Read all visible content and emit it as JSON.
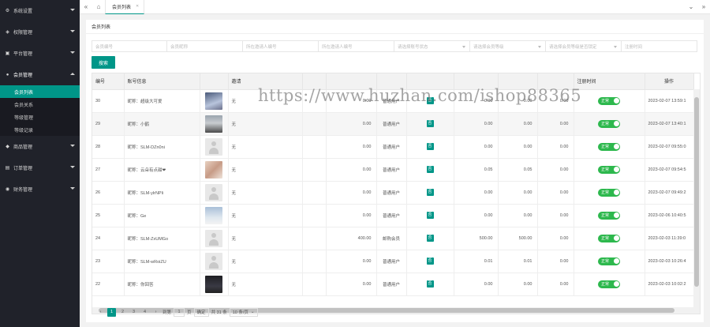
{
  "sidebar": {
    "items": [
      {
        "label": "系统设置",
        "icon": "gear-icon"
      },
      {
        "label": "权限管理",
        "icon": "shield-icon"
      },
      {
        "label": "平台管理",
        "icon": "platform-icon"
      },
      {
        "label": "会员管理",
        "icon": "user-icon",
        "open": true
      },
      {
        "label": "商品管理",
        "icon": "goods-icon"
      },
      {
        "label": "订单管理",
        "icon": "order-icon"
      },
      {
        "label": "财务管理",
        "icon": "finance-icon"
      }
    ],
    "sub_items": [
      "会员列表",
      "会员关系",
      "等级管理",
      "等级记录"
    ]
  },
  "topbar": {
    "tab_label": "会员列表"
  },
  "panel": {
    "title": "会员列表"
  },
  "filters": [
    {
      "placeholder": "会员编号",
      "type": "input"
    },
    {
      "placeholder": "会员昵称",
      "type": "input"
    },
    {
      "placeholder": "所在邀请人编号",
      "type": "input"
    },
    {
      "placeholder": "所在邀请人编号",
      "type": "input"
    },
    {
      "placeholder": "请选择账号状态",
      "type": "select"
    },
    {
      "placeholder": "请选择会员等级",
      "type": "select"
    },
    {
      "placeholder": "请选择会员等级是否锁定",
      "type": "select"
    },
    {
      "placeholder": "注册时间",
      "type": "input"
    }
  ],
  "search_label": "搜索",
  "table": {
    "headers": [
      "编号",
      "账号信息",
      "",
      "邀请",
      "",
      "",
      "",
      "",
      "",
      "",
      "注册时间",
      "操作"
    ],
    "rows": [
      {
        "id": "30",
        "nick": "昵称：超级大可爱",
        "avatar": "av-1",
        "invite": "无",
        "v1": "0.00",
        "level": "普通用户",
        "lock": "否",
        "v2": "0.00",
        "v3": "0.00",
        "v4": "0.00",
        "status": "正常",
        "time": "2023-02-07 13:59:1",
        "edit": "编辑",
        "del": "删除"
      },
      {
        "id": "29",
        "nick": "昵称：小鹤",
        "avatar": "av-2",
        "invite": "无",
        "v1": "0.00",
        "level": "普通用户",
        "lock": "否",
        "v2": "0.00",
        "v3": "0.00",
        "v4": "0.00",
        "status": "正常",
        "time": "2023-02-07 13:40:1",
        "edit": "编辑",
        "del": "删除",
        "hl": true
      },
      {
        "id": "28",
        "nick": "昵称：SLM-DZn0ni",
        "avatar": "av-default",
        "invite": "无",
        "v1": "0.00",
        "level": "普通用户",
        "lock": "否",
        "v2": "0.00",
        "v3": "0.00",
        "v4": "0.00",
        "status": "正常",
        "time": "2023-02-07 09:55:0",
        "edit": "编辑",
        "del": "删除"
      },
      {
        "id": "27",
        "nick": "昵称：云朵有点甜❤",
        "avatar": "av-3",
        "invite": "无",
        "v1": "0.00",
        "level": "普通用户",
        "lock": "否",
        "v2": "0.05",
        "v3": "0.05",
        "v4": "0.00",
        "status": "正常",
        "time": "2023-02-07 09:54:5",
        "edit": "编辑",
        "del": "删除"
      },
      {
        "id": "26",
        "nick": "昵称：SLM-ylrNPli",
        "avatar": "av-default",
        "invite": "无",
        "v1": "0.00",
        "level": "普通用户",
        "lock": "否",
        "v2": "0.00",
        "v3": "0.00",
        "v4": "0.00",
        "status": "正常",
        "time": "2023-02-07 09:49:2",
        "edit": "编辑",
        "del": "删除"
      },
      {
        "id": "25",
        "nick": "昵称：Ge",
        "avatar": "av-4",
        "invite": "无",
        "v1": "0.00",
        "level": "普通用户",
        "lock": "否",
        "v2": "0.00",
        "v3": "0.00",
        "v4": "0.00",
        "status": "正常",
        "time": "2023-02-06 10:40:5",
        "edit": "编辑",
        "del": "删除"
      },
      {
        "id": "24",
        "nick": "昵称：SLM-ZxUMGo",
        "avatar": "av-default",
        "invite": "无",
        "v1": "400.00",
        "level": "邮购会员",
        "lock": "否",
        "v2": "500.00",
        "v3": "500.00",
        "v4": "0.00",
        "status": "正常",
        "time": "2023-02-03 11:39:0",
        "edit": "编辑",
        "del": "删除"
      },
      {
        "id": "23",
        "nick": "昵称：SLM-wRoiZU",
        "avatar": "av-default",
        "invite": "无",
        "v1": "0.00",
        "level": "普通用户",
        "lock": "否",
        "v2": "0.01",
        "v3": "0.01",
        "v4": "0.00",
        "status": "正常",
        "time": "2023-02-03 10:26:4",
        "edit": "编辑",
        "del": "删除"
      },
      {
        "id": "22",
        "nick": "昵称：你回答",
        "avatar": "av-5",
        "invite": "无",
        "v1": "0.00",
        "level": "普通用户",
        "lock": "否",
        "v2": "0.00",
        "v3": "0.00",
        "v4": "0.00",
        "status": "正常",
        "time": "2023-02-03 10:02:2",
        "edit": "编辑",
        "del": "删除"
      }
    ]
  },
  "pager": {
    "pages": [
      "1",
      "2",
      "3",
      "4"
    ],
    "goto_label": "到第",
    "page_value": "1",
    "page_unit": "页",
    "confirm_label": "确定",
    "total_label": "共 31 条",
    "size_label": "10 条/页"
  },
  "watermark": "https://www.huzhan.com/ishop88365"
}
